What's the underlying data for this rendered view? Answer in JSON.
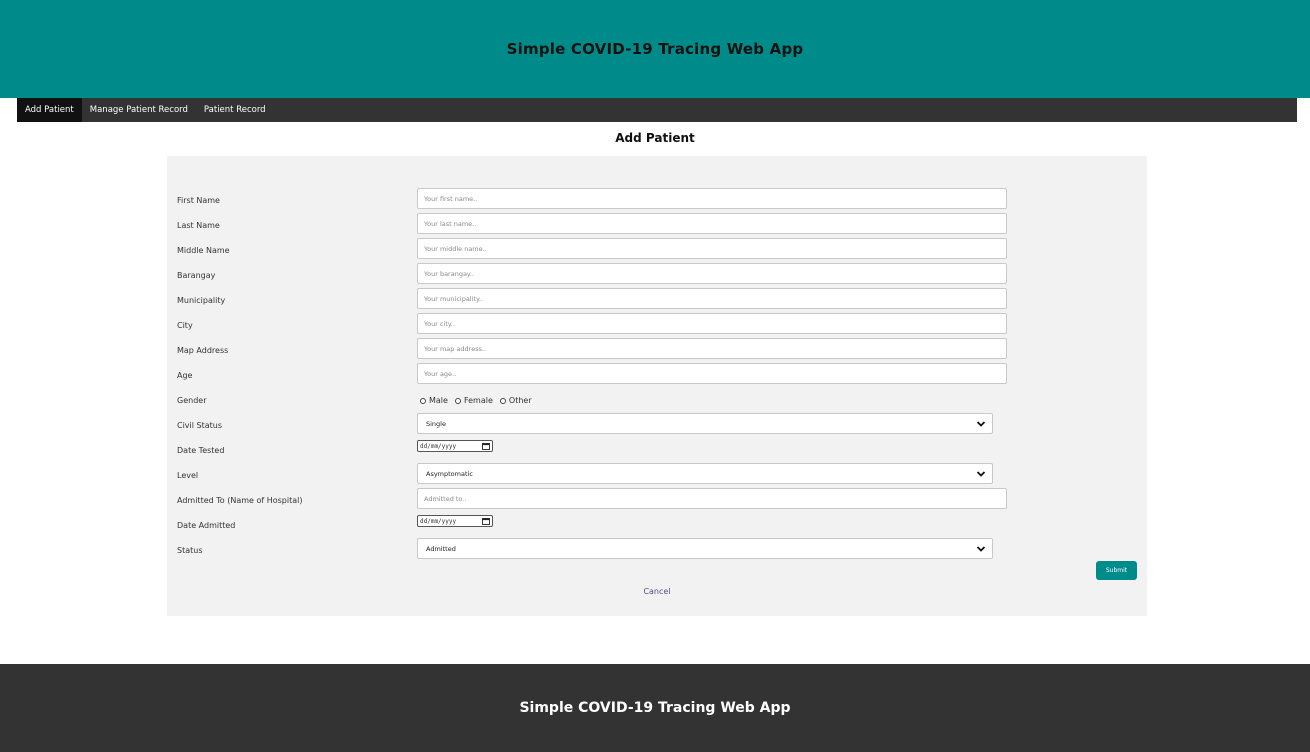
{
  "header": {
    "title": "Simple COVID-19 Tracing Web App"
  },
  "nav": {
    "items": [
      {
        "label": "Add Patient",
        "active": true
      },
      {
        "label": "Manage Patient Record",
        "active": false
      },
      {
        "label": "Patient Record",
        "active": false
      }
    ]
  },
  "page": {
    "heading": "Add Patient"
  },
  "form": {
    "first_name": {
      "label": "First Name",
      "placeholder": "Your first name.."
    },
    "last_name": {
      "label": "Last Name",
      "placeholder": "Your last name.."
    },
    "middle_name": {
      "label": "Middle Name",
      "placeholder": "Your middle name.."
    },
    "barangay": {
      "label": "Barangay",
      "placeholder": "Your barangay.."
    },
    "municipality": {
      "label": "Municipality",
      "placeholder": "Your municipality.."
    },
    "city": {
      "label": "City",
      "placeholder": "Your city.."
    },
    "map_address": {
      "label": "Map Address",
      "placeholder": "Your map address.."
    },
    "age": {
      "label": "Age",
      "placeholder": "Your age.."
    },
    "gender": {
      "label": "Gender",
      "options": [
        "Male",
        "Female",
        "Other"
      ]
    },
    "civil_status": {
      "label": "Civil Status",
      "value": "Single"
    },
    "date_tested": {
      "label": "Date Tested",
      "value": "dd/mm/yyyy"
    },
    "level": {
      "label": "Level",
      "value": "Asymptomatic"
    },
    "admitted_to": {
      "label": "Admitted To (Name of Hospital)",
      "placeholder": "Admitted to.."
    },
    "date_admitted": {
      "label": "Date Admitted",
      "value": "dd/mm/yyyy"
    },
    "status": {
      "label": "Status",
      "value": "Admitted"
    },
    "submit_label": "Submit",
    "cancel_label": "Cancel"
  },
  "footer": {
    "title": "Simple COVID-19 Tracing Web App"
  },
  "colors": {
    "header_bg": "#008b8b",
    "nav_bg": "#333333",
    "nav_active_bg": "#111111",
    "panel_bg": "#f2f2f2",
    "submit_bg": "#008b8b",
    "footer_bg": "#333333"
  },
  "icons": {
    "select_arrow": "chevron-down-icon",
    "date_picker": "calendar-icon",
    "radio": "radio-icon"
  }
}
